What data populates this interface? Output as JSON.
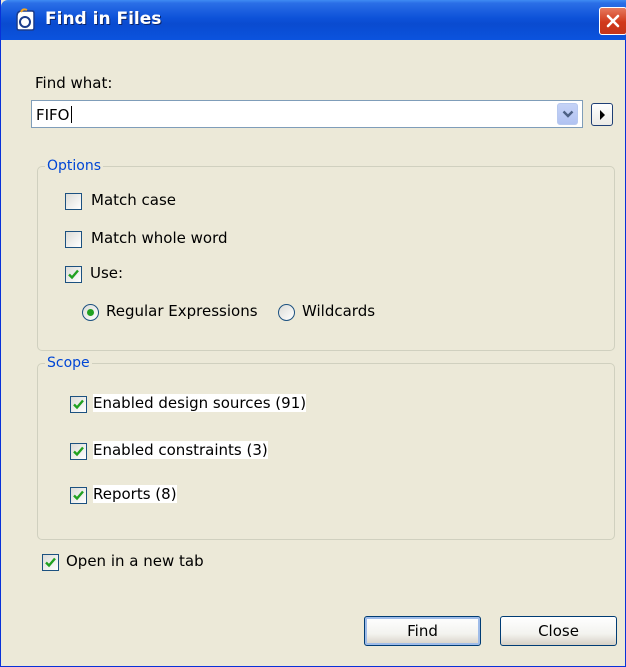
{
  "window": {
    "title": "Find in Files"
  },
  "find": {
    "label": "Find what:",
    "value": "FIFO"
  },
  "options": {
    "legend": "Options",
    "match_case": {
      "label": "Match case",
      "checked": false
    },
    "match_whole_word": {
      "label": "Match whole word",
      "checked": false
    },
    "use": {
      "label": "Use:",
      "checked": true
    },
    "regex": {
      "label": "Regular Expressions",
      "selected": true
    },
    "wildcards": {
      "label": "Wildcards",
      "selected": false
    }
  },
  "scope": {
    "legend": "Scope",
    "items": [
      {
        "label": "Enabled design sources (91)",
        "checked": true
      },
      {
        "label": "Enabled constraints (3)",
        "checked": true
      },
      {
        "label": "Reports (8)",
        "checked": true
      }
    ]
  },
  "open_new_tab": {
    "label": "Open in a new tab",
    "checked": true
  },
  "buttons": {
    "find": "Find",
    "close": "Close"
  },
  "colors": {
    "titlebar": "#0a4bd0",
    "legend": "#0046d5",
    "check": "#21a121",
    "close": "#d1391b"
  }
}
